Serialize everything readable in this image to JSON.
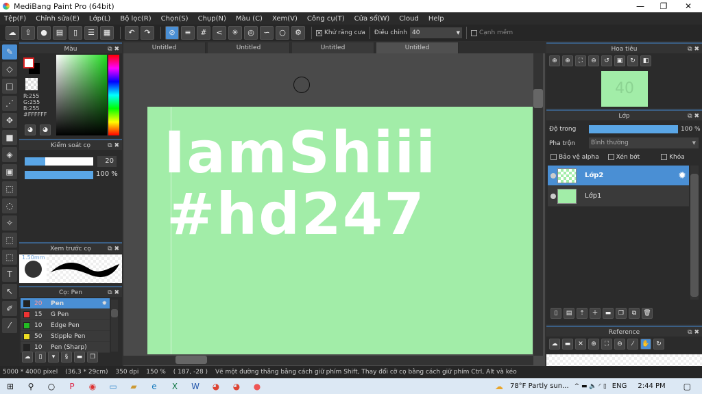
{
  "app": {
    "title": "MediBang Paint Pro (64bit)",
    "min": "—",
    "max": "❐",
    "close": "✕"
  },
  "menu": [
    "Tệp(F)",
    "Chỉnh sửa(E)",
    "Lớp(L)",
    "Bộ lọc(R)",
    "Chọn(S)",
    "Chụp(N)",
    "Màu (C)",
    "Xem(V)",
    "Công cụ(T)",
    "Cửa sổ(W)",
    "Cloud",
    "Help"
  ],
  "toolbar": {
    "antialias": "Khử răng cưa",
    "adjust_label": "Điều chỉnh",
    "adjust_value": "40",
    "smooth": "Cạnh mềm"
  },
  "tabs": [
    "Untitled",
    "Untitled",
    "Untitled",
    "Untitled"
  ],
  "color_panel": {
    "title": "Màu",
    "r": "R:255",
    "g": "G:255",
    "b": "B:255",
    "hex": "#FFFFFF"
  },
  "brush_control": {
    "title": "Kiểm soát cọ",
    "size": "20",
    "opacity": "100 %",
    "size_fraction": 0.3,
    "opacity_fraction": 1.0
  },
  "brush_preview": {
    "title": "Xem trước cọ",
    "size": "1.50mm"
  },
  "brush_list": {
    "title": "Cọ: Pen",
    "items": [
      {
        "size": "20",
        "name": "Pen",
        "color": "#222222"
      },
      {
        "size": "15",
        "name": "G Pen",
        "color": "#ee3333"
      },
      {
        "size": "10",
        "name": "Edge Pen",
        "color": "#22bb22"
      },
      {
        "size": "50",
        "name": "Stipple Pen",
        "color": "#eedd22"
      },
      {
        "size": "10",
        "name": "Pen (Sharp)",
        "color": "#222222"
      }
    ]
  },
  "canvas": {
    "line1": "IamShiii",
    "line2": "#hd247",
    "bg": "#a2eda8"
  },
  "navigator": {
    "title": "Hoa tiêu",
    "thumb_text": "40"
  },
  "layers": {
    "title": "Lớp",
    "opacity_label": "Độ trong",
    "opacity_value": "100 %",
    "blend_label": "Pha trộn",
    "blend_value": "Bình thường",
    "protect_alpha": "Bảo vệ alpha",
    "clip": "Xén bớt",
    "lock": "Khóa",
    "items": [
      "Lớp2",
      "Lớp1"
    ]
  },
  "reference": {
    "title": "Reference"
  },
  "status": {
    "size": "5000 * 4000 pixel",
    "cm": "(36.3 * 29cm)",
    "dpi": "350 dpi",
    "zoom": "150 %",
    "coords": "( 187, -28 )",
    "hint": "Vẽ một đường thẳng bằng cách giữ phím Shift, Thay đổi cỡ cọ bằng cách giữ phím Ctrl, Alt và kéo"
  },
  "taskbar": {
    "weather": "78°F  Partly sun...",
    "lang": "ENG",
    "time": "2:44 PM"
  }
}
